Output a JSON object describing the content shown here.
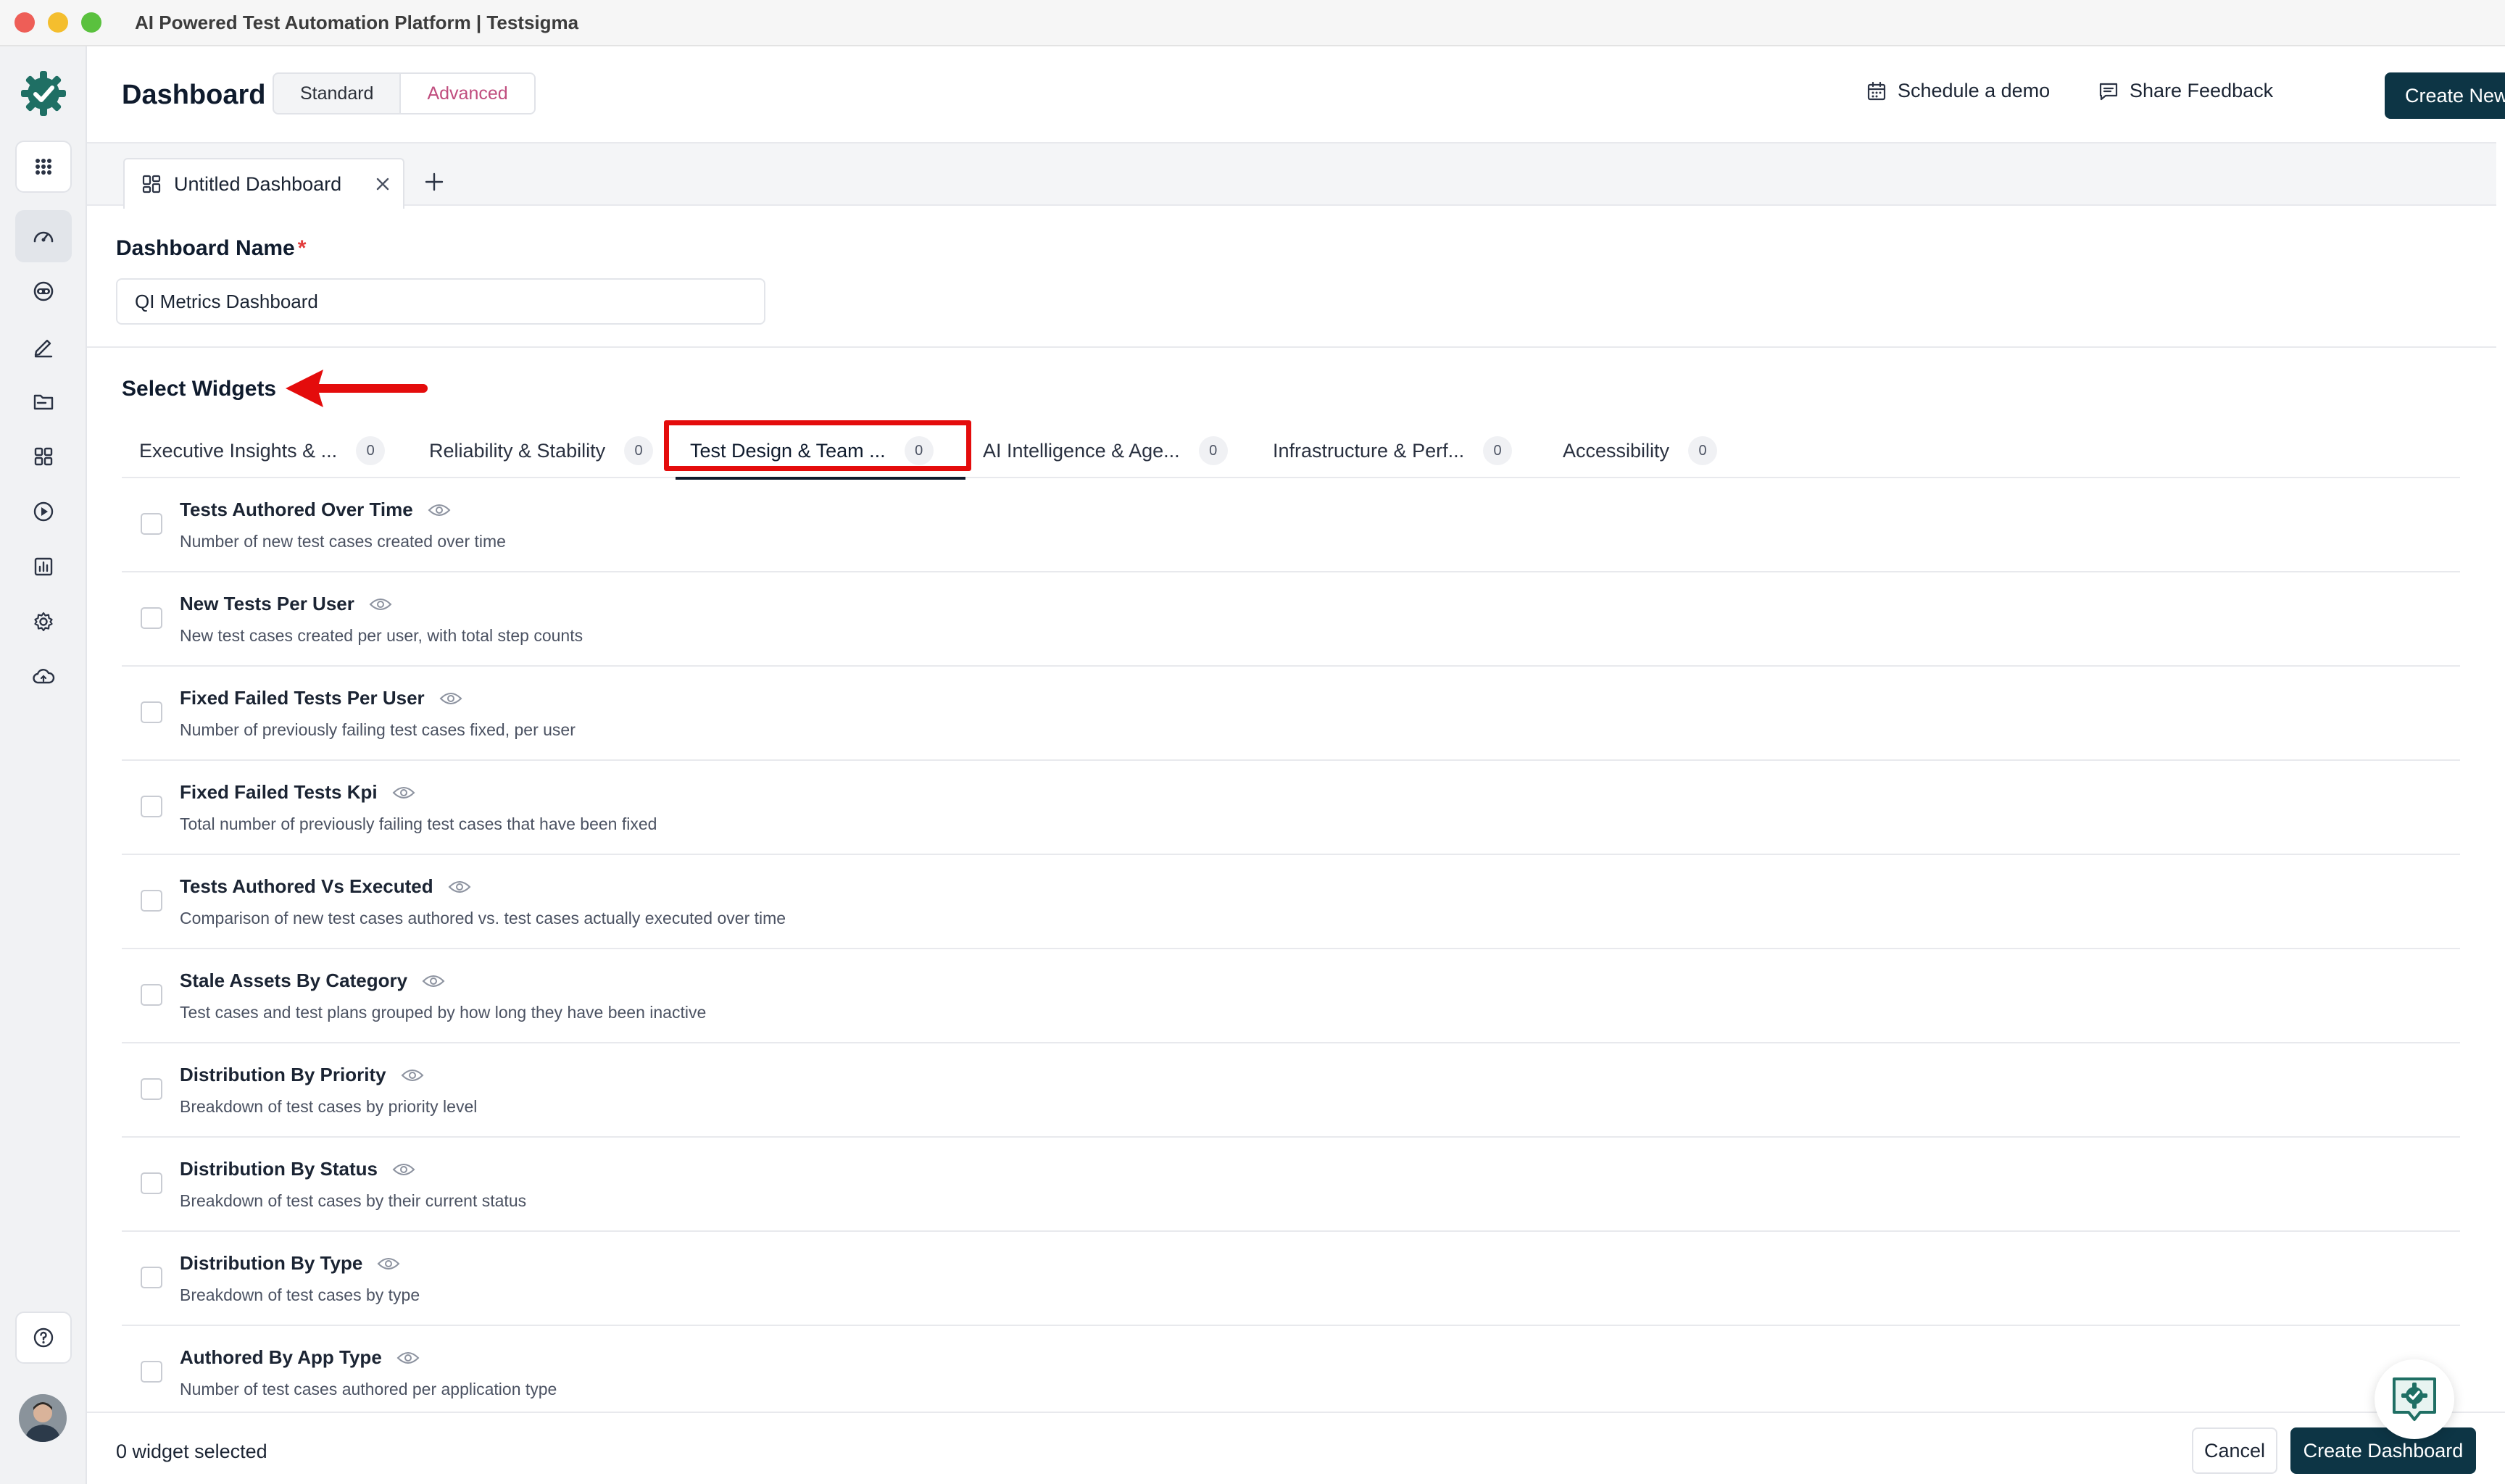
{
  "window": {
    "title": "AI Powered Test Automation Platform | Testsigma"
  },
  "header": {
    "title": "Dashboard",
    "modes": [
      "Standard",
      "Advanced"
    ],
    "schedule_demo": "Schedule a demo",
    "share_feedback": "Share Feedback",
    "create_new": "Create New"
  },
  "tabs": {
    "current": "Untitled Dashboard"
  },
  "form": {
    "name_label": "Dashboard Name",
    "required_mark": "*",
    "name_value": "QI Metrics Dashboard"
  },
  "widgets": {
    "section_title": "Select Widgets",
    "categories": [
      {
        "label": "Executive Insights & ...",
        "count": "0"
      },
      {
        "label": "Reliability & Stability",
        "count": "0"
      },
      {
        "label": "Test Design & Team ...",
        "count": "0"
      },
      {
        "label": "AI Intelligence & Age...",
        "count": "0"
      },
      {
        "label": "Infrastructure & Perf...",
        "count": "0"
      },
      {
        "label": "Accessibility",
        "count": "0"
      }
    ],
    "items": [
      {
        "title": "Tests Authored Over Time",
        "desc": "Number of new test cases created over time"
      },
      {
        "title": "New Tests Per User",
        "desc": "New test cases created per user, with total step counts"
      },
      {
        "title": "Fixed Failed Tests Per User",
        "desc": "Number of previously failing test cases fixed, per user"
      },
      {
        "title": "Fixed Failed Tests Kpi",
        "desc": "Total number of previously failing test cases that have been fixed"
      },
      {
        "title": "Tests Authored Vs Executed",
        "desc": "Comparison of new test cases authored vs. test cases actually executed over time"
      },
      {
        "title": "Stale Assets By Category",
        "desc": "Test cases and test plans grouped by how long they have been inactive"
      },
      {
        "title": "Distribution By Priority",
        "desc": "Breakdown of test cases by priority level"
      },
      {
        "title": "Distribution By Status",
        "desc": "Breakdown of test cases by their current status"
      },
      {
        "title": "Distribution By Type",
        "desc": "Breakdown of test cases by type"
      },
      {
        "title": "Authored By App Type",
        "desc": "Number of test cases authored per application type"
      }
    ]
  },
  "footer": {
    "selected": "0 widget selected",
    "cancel": "Cancel",
    "create": "Create Dashboard"
  },
  "colors": {
    "primary": "#0d3545",
    "annotation": "#e40c0c",
    "advanced_text": "#c04d7e",
    "brand_green": "#1f6f64"
  }
}
